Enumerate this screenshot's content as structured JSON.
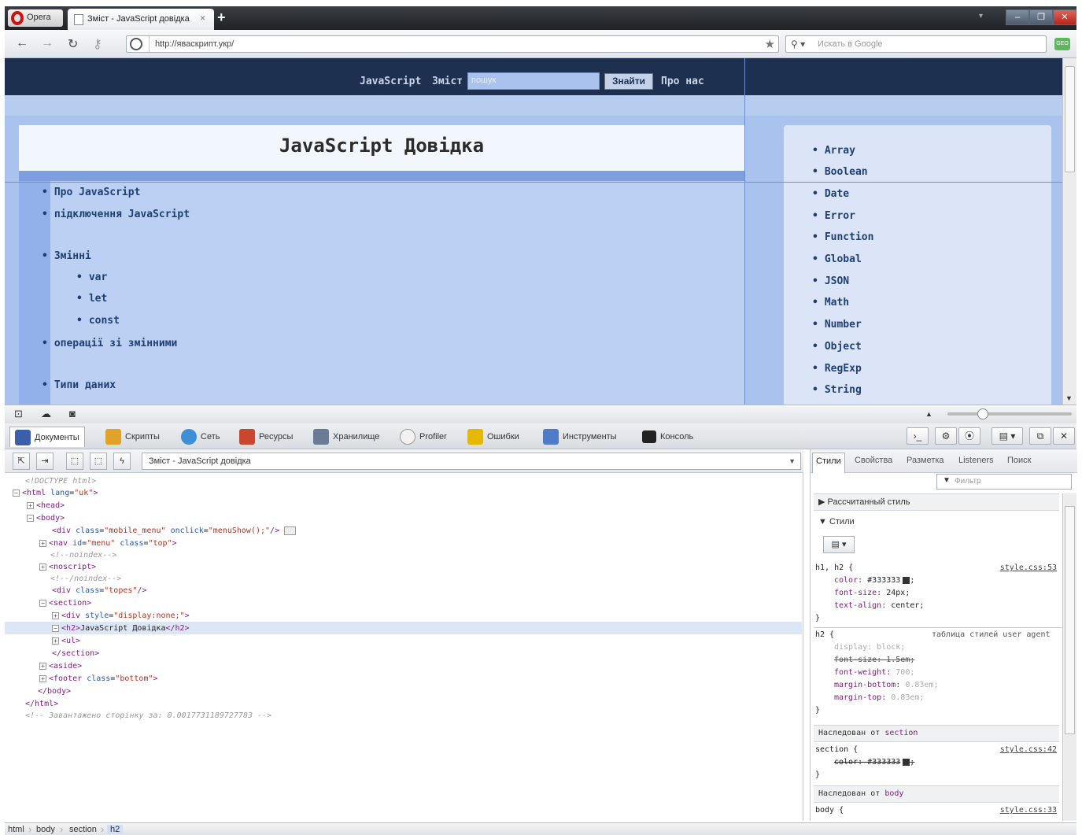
{
  "browser": {
    "menu_label": "Opera",
    "tab_title": "Зміст - JavaScript довідка",
    "url": "http://яваскрипт.укр/",
    "search_placeholder": "Искать в Google",
    "geo_badge": "GEO"
  },
  "page": {
    "nav": {
      "link1": "JavaScript",
      "link2": "Зміст",
      "search_placeholder": "пошук",
      "search_button": "Знайти",
      "link3": "Про нас"
    },
    "title": "JavaScript Довідка",
    "main_list": [
      "Про JavaScript",
      "підключення JavaScript",
      "Змінні",
      "var",
      "let",
      "const",
      "операції зі змінними",
      "Типи даних"
    ],
    "aside_list": [
      "Array",
      "Boolean",
      "Date",
      "Error",
      "Function",
      "Global",
      "JSON",
      "Math",
      "Number",
      "Object",
      "RegExp",
      "String"
    ]
  },
  "devtools": {
    "tabs": [
      "Документы",
      "Скрипты",
      "Сеть",
      "Ресурсы",
      "Хранилище",
      "Profiler",
      "Ошибки",
      "Инструменты",
      "Консоль"
    ],
    "document_selector": "Зміст - JavaScript довідка",
    "dom": {
      "l1": "<!DOCTYPE html>",
      "l2_tag": "<html",
      "l2_attr": "lang",
      "l2_val": "\"uk\"",
      "l3": "<head>",
      "l4": "<body>",
      "l5_tag": "<div",
      "l5_a1": "class",
      "l5_v1": "\"mobile_menu\"",
      "l5_a2": "onclick",
      "l5_v2": "\"menuShow();\"",
      "l5_end": "/>",
      "l6_tag": "<nav",
      "l6_a1": "id",
      "l6_v1": "\"menu\"",
      "l6_a2": "class",
      "l6_v2": "\"top\"",
      "l7": "<!--noindex-->",
      "l8": "<noscript>",
      "l9": "<!--/noindex-->",
      "l10_tag": "<div",
      "l10_a": "class",
      "l10_v": "\"topes\"",
      "l11": "<section>",
      "l12_tag": "<div",
      "l12_a": "style",
      "l12_v": "\"display:none;\"",
      "l13_open": "<h2>",
      "l13_text": "JavaScript Довідка",
      "l13_close": "</h2>",
      "l14": "<ul>",
      "l15": "</section>",
      "l16": "<aside>",
      "l17_tag": "<footer",
      "l17_a": "class",
      "l17_v": "\"bottom\"",
      "l18": "</body>",
      "l19": "</html>",
      "l20": "<!-- Завантажено сторінку за: 0.0017731189727783 -->"
    },
    "styles": {
      "tabs": [
        "Стили",
        "Свойства",
        "Разметка",
        "Listeners",
        "Поиск"
      ],
      "filter_placeholder": "Фильтр",
      "computed_header": "Рассчитанный стиль",
      "styles_header": "Стили",
      "rule1_selector": "h1, h2 {",
      "rule1_source": "style.css:53",
      "rule1_p1": "color:",
      "rule1_v1": "#333333",
      "rule1_p2": "font-size:",
      "rule1_v2": "24px;",
      "rule1_p3": "text-align:",
      "rule1_v3": "center;",
      "rule2_selector": "h2 {",
      "rule2_source": "таблица стилей user agent",
      "rule2_l1": "display: block;",
      "rule2_l2": "font-size: 1.5em;",
      "rule2_l3_p": "font-weight:",
      "rule2_l3_v": "700;",
      "rule2_l4_p": "margin-bottom:",
      "rule2_l4_v": "0.83em;",
      "rule2_l5_p": "margin-top:",
      "rule2_l5_v": "0.83em;",
      "inherit1_prefix": "Наследован от",
      "inherit1_el": "section",
      "rule3_selector": "section {",
      "rule3_source": "style.css:42",
      "rule3_l1": "color: #333333",
      "inherit2_prefix": "Наследован от",
      "inherit2_el": "body",
      "rule4_selector": "body {",
      "rule4_source": "style.css:33",
      "close_brace": "}"
    },
    "breadcrumb": [
      "html",
      "body",
      "section",
      "h2"
    ]
  }
}
